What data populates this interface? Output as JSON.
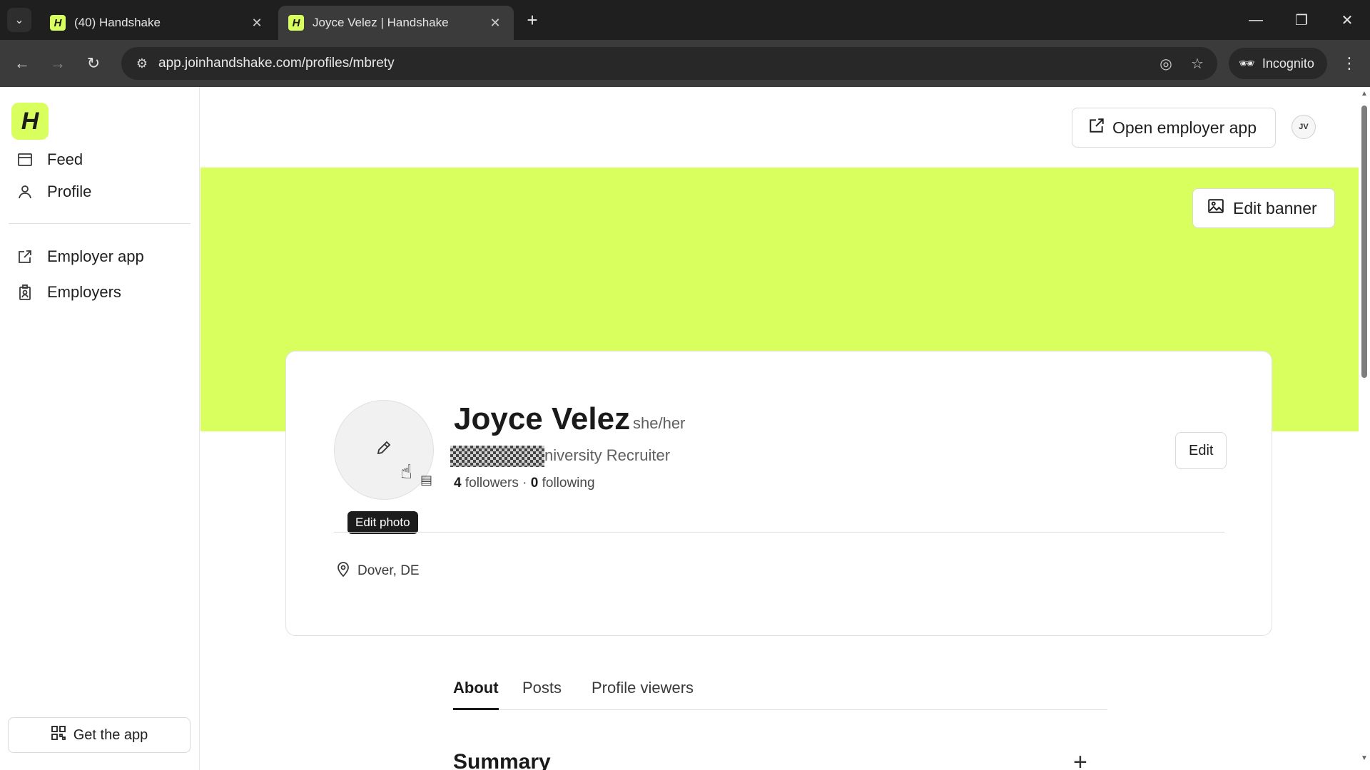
{
  "browser": {
    "tabs": [
      {
        "title": "(40) Handshake",
        "favicon": "H"
      },
      {
        "title": "Joyce Velez | Handshake",
        "favicon": "H"
      }
    ],
    "url": "app.joinhandshake.com/profiles/mbrety",
    "incognito_label": "Incognito"
  },
  "sidebar": {
    "logo": "H",
    "items": [
      {
        "label": "Feed",
        "icon": "feed-icon"
      },
      {
        "label": "Profile",
        "icon": "person-icon"
      },
      {
        "label": "Employer app",
        "icon": "external-link-icon"
      },
      {
        "label": "Employers",
        "icon": "badge-icon"
      }
    ],
    "get_app_label": "Get the app"
  },
  "header": {
    "open_employer_label": "Open employer app",
    "avatar_initials": "JV"
  },
  "banner": {
    "edit_banner_label": "Edit banner",
    "color": "#d9ff5e"
  },
  "profile": {
    "name": "Joyce Velez",
    "pronouns": "she/her",
    "headline_visible": "niversity Recruiter",
    "followers_count": "4",
    "followers_label": "followers",
    "following_count": "0",
    "following_label": "following",
    "edit_label": "Edit",
    "edit_photo_tooltip": "Edit photo",
    "location": "Dover, DE"
  },
  "profile_tabs": [
    {
      "label": "About",
      "active": true
    },
    {
      "label": "Posts",
      "active": false
    },
    {
      "label": "Profile viewers",
      "active": false
    }
  ],
  "summary": {
    "title": "Summary",
    "add_icon": "+"
  }
}
